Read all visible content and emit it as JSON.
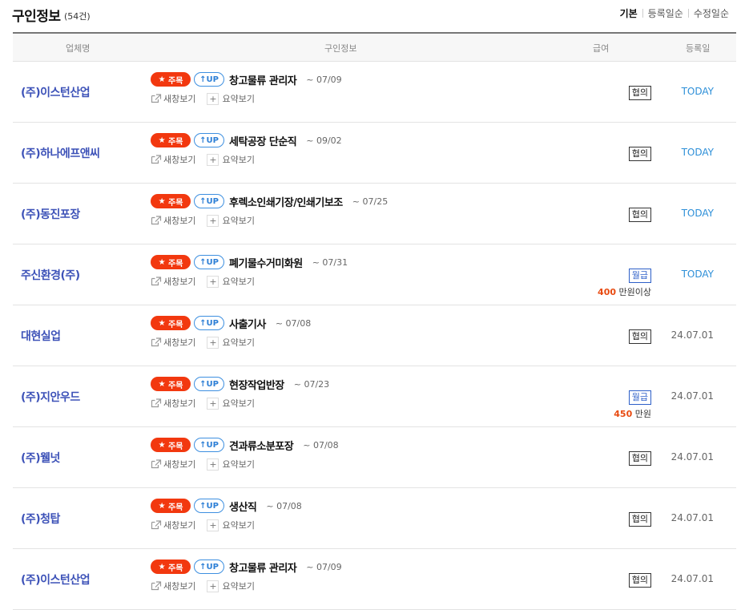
{
  "header": {
    "title": "구인정보",
    "count": "(54건)",
    "sort": [
      {
        "label": "기본",
        "active": true
      },
      {
        "label": "등록일순",
        "active": false
      },
      {
        "label": "수정일순",
        "active": false
      }
    ]
  },
  "table": {
    "columns": [
      "업체명",
      "구인정보",
      "급여",
      "등록일"
    ],
    "star_badge": "주목",
    "up_badge": "UP",
    "new_window_label": "새창보기",
    "summary_label": "요약보기",
    "rows": [
      {
        "company": "(주)이스턴산업",
        "title": "창고물류 관리자",
        "deadline": "~ 07/09",
        "pay_type": "협의",
        "pay_amount": "",
        "pay_unit": "",
        "date": "TODAY",
        "today": true
      },
      {
        "company": "(주)하나에프앤씨",
        "title": "세탁공장 단순직",
        "deadline": "~ 09/02",
        "pay_type": "협의",
        "pay_amount": "",
        "pay_unit": "",
        "date": "TODAY",
        "today": true
      },
      {
        "company": "(주)동진포장",
        "title": "후렉소인쇄기장/인쇄기보조",
        "deadline": "~ 07/25",
        "pay_type": "협의",
        "pay_amount": "",
        "pay_unit": "",
        "date": "TODAY",
        "today": true
      },
      {
        "company": "주신환경(주)",
        "title": "폐기물수거미화원",
        "deadline": "~ 07/31",
        "pay_type": "월급",
        "pay_amount": "400",
        "pay_unit": "만원이상",
        "date": "TODAY",
        "today": true
      },
      {
        "company": "대현실업",
        "title": "사출기사",
        "deadline": "~ 07/08",
        "pay_type": "협의",
        "pay_amount": "",
        "pay_unit": "",
        "date": "24.07.01",
        "today": false
      },
      {
        "company": "(주)지안우드",
        "title": "현장작업반장",
        "deadline": "~ 07/23",
        "pay_type": "월급",
        "pay_amount": "450",
        "pay_unit": "만원",
        "date": "24.07.01",
        "today": false
      },
      {
        "company": "(주)웰넛",
        "title": "견과류소분포장",
        "deadline": "~ 07/08",
        "pay_type": "협의",
        "pay_amount": "",
        "pay_unit": "",
        "date": "24.07.01",
        "today": false
      },
      {
        "company": "(주)청탑",
        "title": "생산직",
        "deadline": "~ 07/08",
        "pay_type": "협의",
        "pay_amount": "",
        "pay_unit": "",
        "date": "24.07.01",
        "today": false
      },
      {
        "company": "(주)이스턴산업",
        "title": "창고물류 관리자",
        "deadline": "~ 07/09",
        "pay_type": "협의",
        "pay_amount": "",
        "pay_unit": "",
        "date": "24.07.01",
        "today": false
      }
    ]
  }
}
